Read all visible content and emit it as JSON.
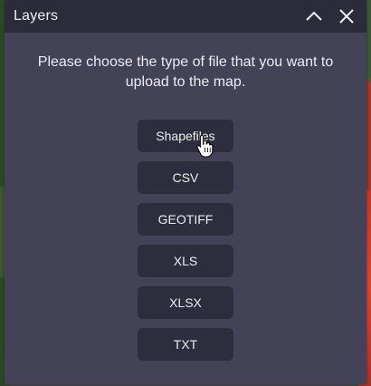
{
  "window": {
    "title": "Layers"
  },
  "header": {
    "collapse_icon": "chevron-up-icon",
    "close_icon": "close-icon"
  },
  "message": "Please choose the type of file that you want to upload to the map.",
  "file_types": [
    {
      "label": "Shapefiles"
    },
    {
      "label": "CSV"
    },
    {
      "label": "GEOTIFF"
    },
    {
      "label": "XLS"
    },
    {
      "label": "XLSX"
    },
    {
      "label": "TXT"
    }
  ],
  "colors": {
    "panel": "#434257",
    "header": "#2c2b3a",
    "button": "#2e2d3d",
    "text": "#ececf0"
  }
}
